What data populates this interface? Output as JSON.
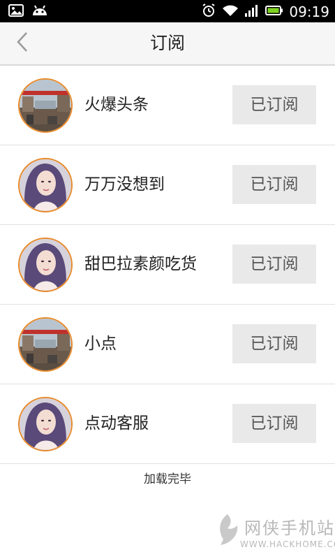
{
  "status_bar": {
    "time": "09:19",
    "icons": [
      "image-icon",
      "android-icon",
      "alarm-icon",
      "wifi-icon",
      "signal-icon",
      "battery-icon"
    ]
  },
  "header": {
    "title": "订阅",
    "back_icon": "chevron-left-icon"
  },
  "subscriptions": [
    {
      "name": "火爆头条",
      "button_label": "已订阅",
      "avatar": "street"
    },
    {
      "name": "万万没想到",
      "button_label": "已订阅",
      "avatar": "woman"
    },
    {
      "name": "甜巴拉素颜吃货",
      "button_label": "已订阅",
      "avatar": "woman"
    },
    {
      "name": "小点",
      "button_label": "已订阅",
      "avatar": "street"
    },
    {
      "name": "点动客服",
      "button_label": "已订阅",
      "avatar": "woman"
    }
  ],
  "footer": {
    "load_complete": "加载完毕"
  },
  "watermark": {
    "cn": "网侠手机站",
    "en": "WWW.HACKHOME.COM"
  },
  "colors": {
    "avatar_border": "#e88a2a",
    "button_bg": "#e9e9e9",
    "header_bg": "#f6f6f6"
  }
}
